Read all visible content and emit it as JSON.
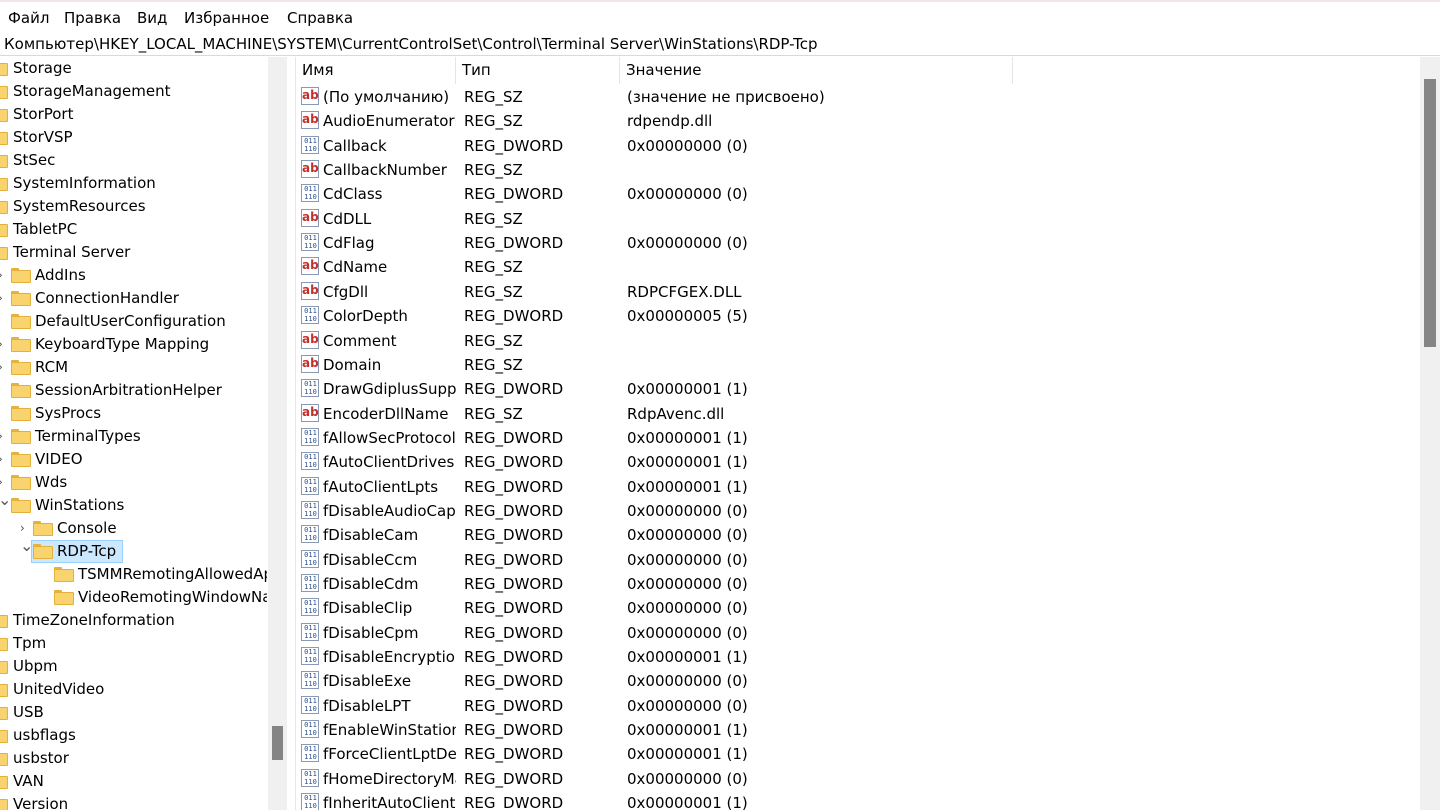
{
  "menu": [
    "Файл",
    "Правка",
    "Вид",
    "Избранное",
    "Справка"
  ],
  "address": "Компьютер\\HKEY_LOCAL_MACHINE\\SYSTEM\\CurrentControlSet\\Control\\Terminal Server\\WinStations\\RDP-Tcp",
  "tree": [
    {
      "label": "Storage",
      "level": 0,
      "expander": "none"
    },
    {
      "label": "StorageManagement",
      "level": 0,
      "expander": "none"
    },
    {
      "label": "StorPort",
      "level": 0,
      "expander": "none"
    },
    {
      "label": "StorVSP",
      "level": 0,
      "expander": "none"
    },
    {
      "label": "StSec",
      "level": 0,
      "expander": "none"
    },
    {
      "label": "SystemInformation",
      "level": 0,
      "expander": "none"
    },
    {
      "label": "SystemResources",
      "level": 0,
      "expander": "none"
    },
    {
      "label": "TabletPC",
      "level": 0,
      "expander": "none"
    },
    {
      "label": "Terminal Server",
      "level": 0,
      "expander": "none"
    },
    {
      "label": "AddIns",
      "level": 1,
      "expander": "collapsed"
    },
    {
      "label": "ConnectionHandler",
      "level": 1,
      "expander": "collapsed"
    },
    {
      "label": "DefaultUserConfiguration",
      "level": 1,
      "expander": "none"
    },
    {
      "label": "KeyboardType Mapping",
      "level": 1,
      "expander": "collapsed"
    },
    {
      "label": "RCM",
      "level": 1,
      "expander": "collapsed"
    },
    {
      "label": "SessionArbitrationHelper",
      "level": 1,
      "expander": "none"
    },
    {
      "label": "SysProcs",
      "level": 1,
      "expander": "none"
    },
    {
      "label": "TerminalTypes",
      "level": 1,
      "expander": "collapsed"
    },
    {
      "label": "VIDEO",
      "level": 1,
      "expander": "collapsed"
    },
    {
      "label": "Wds",
      "level": 1,
      "expander": "collapsed"
    },
    {
      "label": "WinStations",
      "level": 1,
      "expander": "expanded"
    },
    {
      "label": "Console",
      "level": 2,
      "expander": "collapsed"
    },
    {
      "label": "RDP-Tcp",
      "level": 2,
      "expander": "expanded",
      "selected": true
    },
    {
      "label": "TSMMRemotingAllowedApps",
      "level": 3,
      "expander": "none"
    },
    {
      "label": "VideoRemotingWindowNames",
      "level": 3,
      "expander": "none"
    },
    {
      "label": "TimeZoneInformation",
      "level": 0,
      "expander": "none"
    },
    {
      "label": "Tpm",
      "level": 0,
      "expander": "none"
    },
    {
      "label": "Ubpm",
      "level": 0,
      "expander": "none"
    },
    {
      "label": "UnitedVideo",
      "level": 0,
      "expander": "none"
    },
    {
      "label": "USB",
      "level": 0,
      "expander": "none"
    },
    {
      "label": "usbflags",
      "level": 0,
      "expander": "none"
    },
    {
      "label": "usbstor",
      "level": 0,
      "expander": "none"
    },
    {
      "label": "VAN",
      "level": 0,
      "expander": "none"
    },
    {
      "label": "Version",
      "level": 0,
      "expander": "none"
    }
  ],
  "columns": {
    "name": "Имя",
    "type": "Тип",
    "value": "Значение"
  },
  "icon_text": {
    "sz": "ab",
    "dword_top": "011",
    "dword_bottom": "110"
  },
  "values": [
    {
      "name": "(По умолчанию)",
      "type": "REG_SZ",
      "data": "(значение не присвоено)"
    },
    {
      "name": "AudioEnumeratorDll",
      "type": "REG_SZ",
      "data": "rdpendp.dll"
    },
    {
      "name": "Callback",
      "type": "REG_DWORD",
      "data": "0x00000000 (0)"
    },
    {
      "name": "CallbackNumber",
      "type": "REG_SZ",
      "data": ""
    },
    {
      "name": "CdClass",
      "type": "REG_DWORD",
      "data": "0x00000000 (0)"
    },
    {
      "name": "CdDLL",
      "type": "REG_SZ",
      "data": ""
    },
    {
      "name": "CdFlag",
      "type": "REG_DWORD",
      "data": "0x00000000 (0)"
    },
    {
      "name": "CdName",
      "type": "REG_SZ",
      "data": ""
    },
    {
      "name": "CfgDll",
      "type": "REG_SZ",
      "data": "RDPCFGEX.DLL"
    },
    {
      "name": "ColorDepth",
      "type": "REG_DWORD",
      "data": "0x00000005 (5)"
    },
    {
      "name": "Comment",
      "type": "REG_SZ",
      "data": ""
    },
    {
      "name": "Domain",
      "type": "REG_SZ",
      "data": ""
    },
    {
      "name": "DrawGdiplusSupportLevel",
      "type": "REG_DWORD",
      "data": "0x00000001 (1)"
    },
    {
      "name": "EncoderDllName",
      "type": "REG_SZ",
      "data": "RdpAvenc.dll"
    },
    {
      "name": "fAllowSecProtocolNegotiation",
      "type": "REG_DWORD",
      "data": "0x00000001 (1)"
    },
    {
      "name": "fAutoClientDrives",
      "type": "REG_DWORD",
      "data": "0x00000001 (1)"
    },
    {
      "name": "fAutoClientLpts",
      "type": "REG_DWORD",
      "data": "0x00000001 (1)"
    },
    {
      "name": "fDisableAudioCapture",
      "type": "REG_DWORD",
      "data": "0x00000000 (0)"
    },
    {
      "name": "fDisableCam",
      "type": "REG_DWORD",
      "data": "0x00000000 (0)"
    },
    {
      "name": "fDisableCcm",
      "type": "REG_DWORD",
      "data": "0x00000000 (0)"
    },
    {
      "name": "fDisableCdm",
      "type": "REG_DWORD",
      "data": "0x00000000 (0)"
    },
    {
      "name": "fDisableClip",
      "type": "REG_DWORD",
      "data": "0x00000000 (0)"
    },
    {
      "name": "fDisableCpm",
      "type": "REG_DWORD",
      "data": "0x00000000 (0)"
    },
    {
      "name": "fDisableEncryption",
      "type": "REG_DWORD",
      "data": "0x00000001 (1)"
    },
    {
      "name": "fDisableExe",
      "type": "REG_DWORD",
      "data": "0x00000000 (0)"
    },
    {
      "name": "fDisableLPT",
      "type": "REG_DWORD",
      "data": "0x00000000 (0)"
    },
    {
      "name": "fEnableWinStation",
      "type": "REG_DWORD",
      "data": "0x00000001 (1)"
    },
    {
      "name": "fForceClientLptDef",
      "type": "REG_DWORD",
      "data": "0x00000001 (1)"
    },
    {
      "name": "fHomeDirectoryMapRoot",
      "type": "REG_DWORD",
      "data": "0x00000000 (0)"
    },
    {
      "name": "fInheritAutoClient",
      "type": "REG_DWORD",
      "data": "0x00000001 (1)"
    }
  ],
  "colors": {
    "folder": "#f8d36e",
    "selection": "#cce8ff",
    "sz_icon": "#c4302b",
    "dword_icon": "#2b4f8c"
  }
}
